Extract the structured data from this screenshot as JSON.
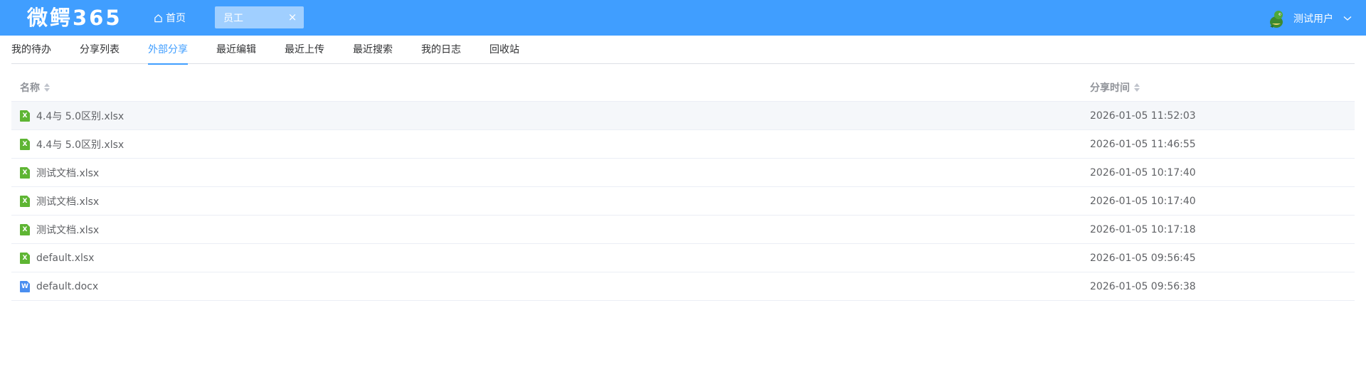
{
  "header": {
    "logo": "微鳄365",
    "home_label": "首页",
    "open_tab": "员工",
    "tab_close": "×",
    "user_name": "测试用户",
    "accent_color": "#409eff"
  },
  "subnav": {
    "items": [
      {
        "label": "我的待办"
      },
      {
        "label": "分享列表"
      },
      {
        "label": "外部分享",
        "active": true
      },
      {
        "label": "最近编辑"
      },
      {
        "label": "最近上传"
      },
      {
        "label": "最近搜索"
      },
      {
        "label": "我的日志"
      },
      {
        "label": "回收站"
      }
    ]
  },
  "table": {
    "columns": {
      "name": "名称",
      "time": "分享时间"
    },
    "rows": [
      {
        "name": "4.4与 5.0区别.xlsx",
        "type": "xlsx",
        "icon_letter": "X",
        "time": "2026-01-05 11:52:03"
      },
      {
        "name": "4.4与 5.0区别.xlsx",
        "type": "xlsx",
        "icon_letter": "X",
        "time": "2026-01-05 11:46:55"
      },
      {
        "name": "测试文档.xlsx",
        "type": "xlsx",
        "icon_letter": "X",
        "time": "2026-01-05 10:17:40"
      },
      {
        "name": "测试文档.xlsx",
        "type": "xlsx",
        "icon_letter": "X",
        "time": "2026-01-05 10:17:40"
      },
      {
        "name": "测试文档.xlsx",
        "type": "xlsx",
        "icon_letter": "X",
        "time": "2026-01-05 10:17:18"
      },
      {
        "name": "default.xlsx",
        "type": "xlsx",
        "icon_letter": "X",
        "time": "2026-01-05 09:56:45"
      },
      {
        "name": "default.docx",
        "type": "docx",
        "icon_letter": "W",
        "time": "2026-01-05 09:56:38"
      }
    ]
  }
}
